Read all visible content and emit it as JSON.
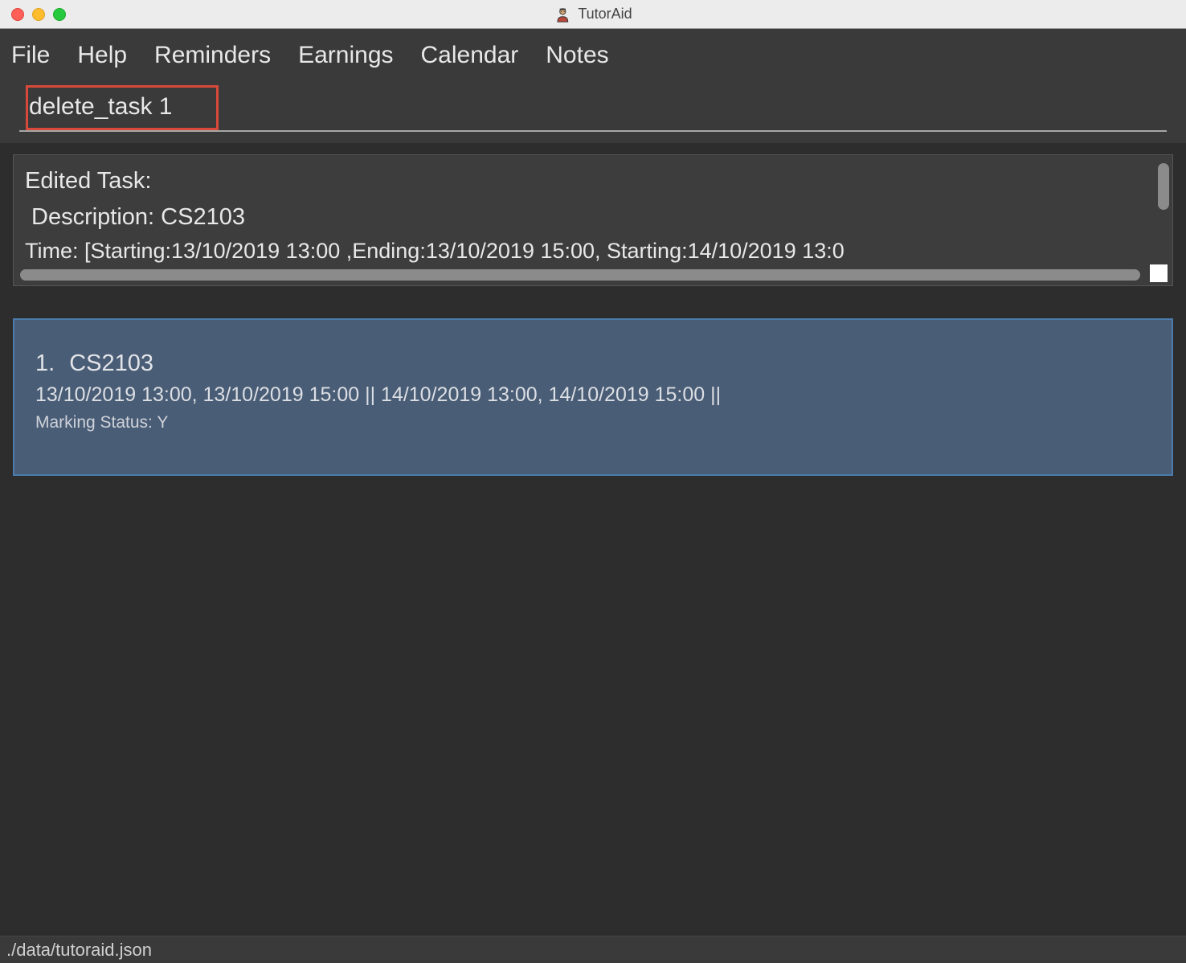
{
  "app": {
    "title": "TutorAid"
  },
  "menu": {
    "items": [
      "File",
      "Help",
      "Reminders",
      "Earnings",
      "Calendar",
      "Notes"
    ]
  },
  "command": {
    "value": "delete_task 1"
  },
  "result": {
    "line1": "Edited Task:",
    "line2": "Description: CS2103",
    "line3": "Time: [Starting:13/10/2019 13:00 ,Ending:13/10/2019 15:00, Starting:14/10/2019 13:0"
  },
  "task_list": [
    {
      "index": "1.",
      "name": "CS2103",
      "times": "13/10/2019 13:00, 13/10/2019 15:00 || 14/10/2019 13:00, 14/10/2019 15:00 ||",
      "status": "Marking Status: Y"
    }
  ],
  "status": {
    "path": "./data/tutoraid.json"
  }
}
